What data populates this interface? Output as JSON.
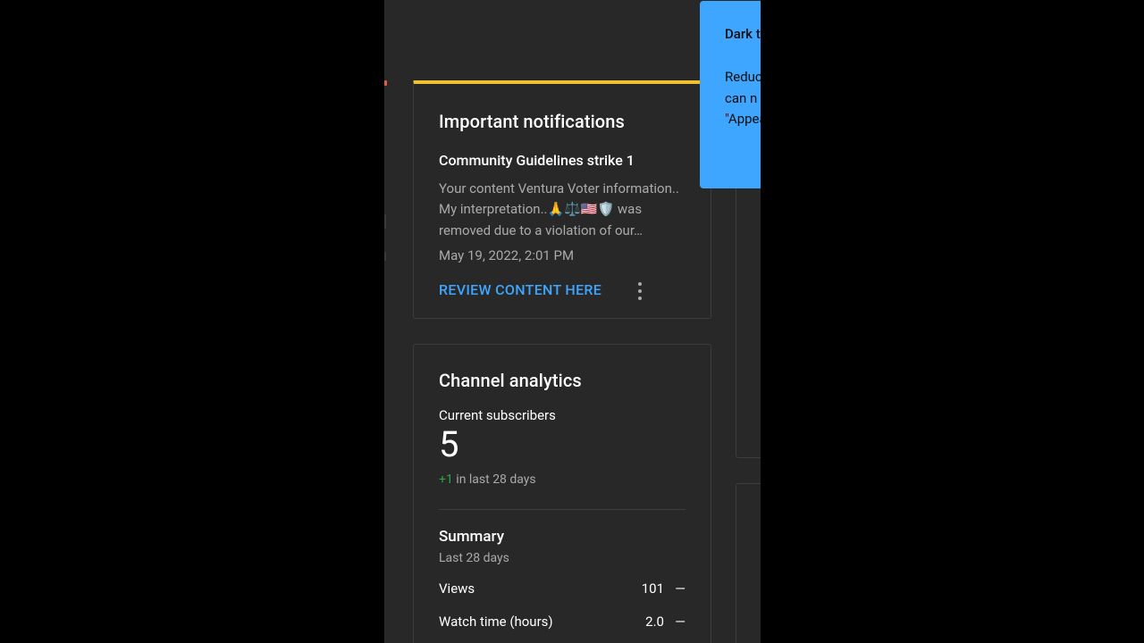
{
  "notifications": {
    "title": "Important notifications",
    "strike_title": "Community Guidelines strike 1",
    "strike_body": "Your content Ventura Voter information.. My interpretation..🙏⚖️🇺🇸🛡️ was removed due to a violation of our…",
    "date": "May 19, 2022, 2:01 PM",
    "review_label": "REVIEW CONTENT HERE",
    "accent_color": "#f2c12e",
    "link_color": "#3ea6ff"
  },
  "analytics": {
    "title": "Channel analytics",
    "subscribers_label": "Current subscribers",
    "subscribers_value": "5",
    "delta_value": "+1",
    "delta_text": " in last 28 days",
    "delta_color": "#2ba640",
    "summary_title": "Summary",
    "summary_period": "Last 28 days",
    "metrics": [
      {
        "label": "Views",
        "value": "101",
        "trend": "—"
      },
      {
        "label": "Watch time (hours)",
        "value": "2.0",
        "trend": "—"
      }
    ]
  },
  "tooltip": {
    "title": "Dark t",
    "body_lines": [
      "Reduc",
      "can n",
      "\"Appea"
    ],
    "bg_color": "#3ea6ff"
  },
  "icons": {
    "more": "more-vert-icon"
  }
}
